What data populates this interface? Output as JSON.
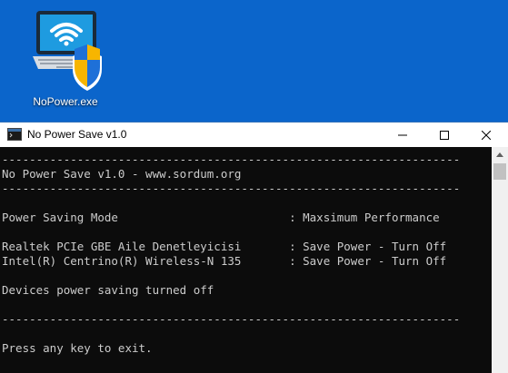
{
  "desktop": {
    "icon_label": "NoPower.exe",
    "icon": "laptop-wifi-shield-icon"
  },
  "window": {
    "title": "No Power Save v1.0",
    "app_icon": "console-window-icon",
    "controls": [
      "minimize-icon",
      "maximize-icon",
      "close-icon"
    ]
  },
  "console": {
    "lines": [
      "-------------------------------------------------------------------",
      "No Power Save v1.0 - www.sordum.org",
      "-------------------------------------------------------------------",
      "",
      "Power Saving Mode                         : Maxsimum Performance",
      "",
      "Realtek PCIe GBE Aile Denetleyicisi       : Save Power - Turn Off",
      "Intel(R) Centrino(R) Wireless-N 135       : Save Power - Turn Off",
      "",
      "Devices power saving turned off",
      "",
      "-------------------------------------------------------------------",
      "",
      "Press any key to exit."
    ]
  },
  "colors": {
    "desktop_bg": "#0b65cb",
    "console_bg": "#0c0c0c",
    "console_text": "#cccccc",
    "titlebar_bg": "#ffffff"
  }
}
